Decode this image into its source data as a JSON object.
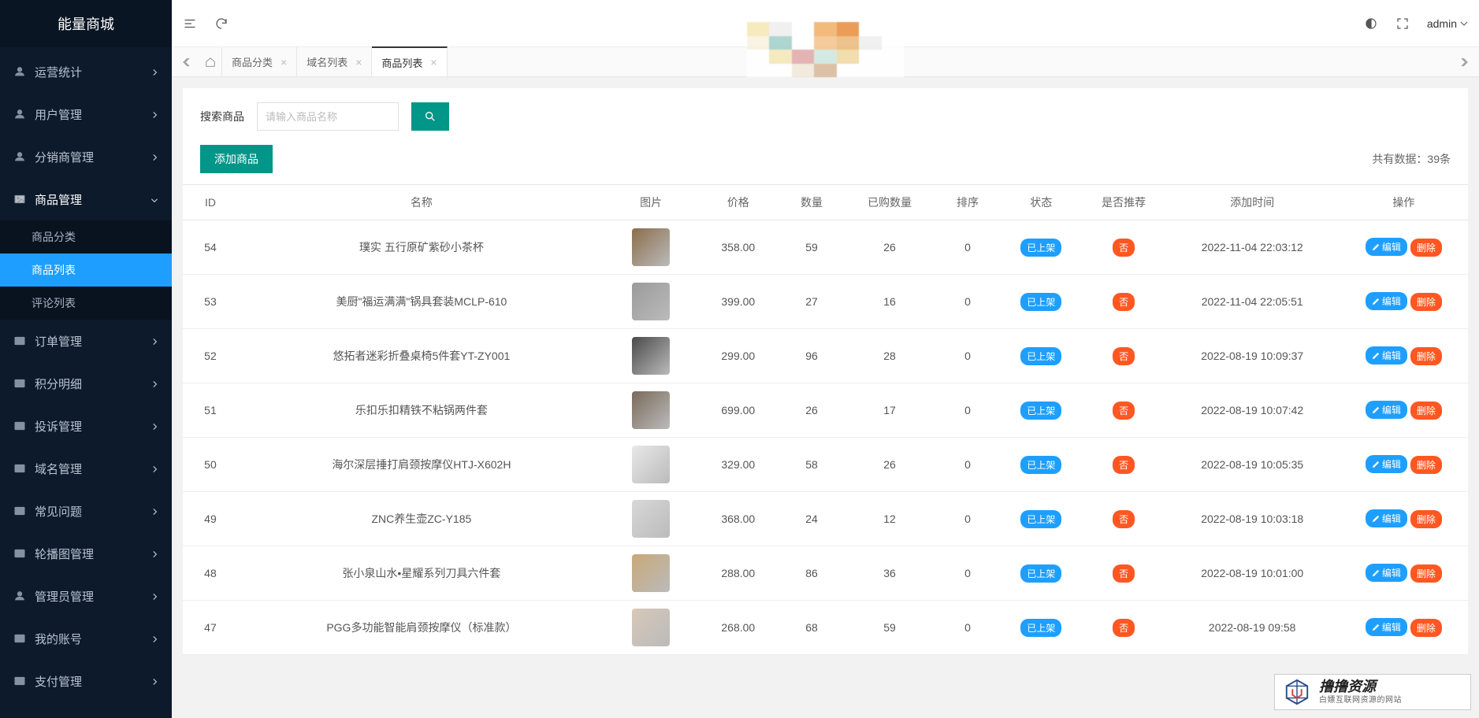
{
  "app": {
    "title": "能量商城",
    "admin": "admin"
  },
  "sidebar": {
    "items": [
      {
        "label": "运营统计"
      },
      {
        "label": "用户管理"
      },
      {
        "label": "分销商管理"
      },
      {
        "label": "商品管理",
        "active": true,
        "expanded": true,
        "children": [
          {
            "label": "商品分类"
          },
          {
            "label": "商品列表",
            "selected": true
          },
          {
            "label": "评论列表"
          }
        ]
      },
      {
        "label": "订单管理"
      },
      {
        "label": "积分明细"
      },
      {
        "label": "投诉管理"
      },
      {
        "label": "域名管理"
      },
      {
        "label": "常见问题"
      },
      {
        "label": "轮播图管理"
      },
      {
        "label": "管理员管理"
      },
      {
        "label": "我的账号"
      },
      {
        "label": "支付管理"
      }
    ]
  },
  "tabs": {
    "items": [
      {
        "label": "商品分类"
      },
      {
        "label": "域名列表"
      },
      {
        "label": "商品列表",
        "active": true
      }
    ]
  },
  "search": {
    "label": "搜索商品",
    "placeholder": "请输入商品名称"
  },
  "actions": {
    "add": "添加商品",
    "count_prefix": "共有数据：",
    "count": "39条"
  },
  "table": {
    "headers": {
      "id": "ID",
      "name": "名称",
      "img": "图片",
      "price": "价格",
      "qty": "数量",
      "bought": "已购数量",
      "sort": "排序",
      "status": "状态",
      "rec": "是否推荐",
      "time": "添加时间",
      "ops": "操作"
    },
    "status_label": "已上架",
    "rec_no": "否",
    "edit": "编辑",
    "del": "删除",
    "rows": [
      {
        "id": "54",
        "name": "璞实 五行原矿紫砂小茶杯",
        "price": "358.00",
        "qty": "59",
        "bought": "26",
        "sort": "0",
        "time": "2022-11-04 22:03:12"
      },
      {
        "id": "53",
        "name": "美厨\"福运满满\"锅具套装MCLP-610",
        "price": "399.00",
        "qty": "27",
        "bought": "16",
        "sort": "0",
        "time": "2022-11-04 22:05:51"
      },
      {
        "id": "52",
        "name": "悠拓者迷彩折叠桌椅5件套YT-ZY001",
        "price": "299.00",
        "qty": "96",
        "bought": "28",
        "sort": "0",
        "time": "2022-08-19 10:09:37"
      },
      {
        "id": "51",
        "name": "乐扣乐扣精铁不粘锅两件套",
        "price": "699.00",
        "qty": "26",
        "bought": "17",
        "sort": "0",
        "time": "2022-08-19 10:07:42"
      },
      {
        "id": "50",
        "name": "海尔深层捶打肩颈按摩仪HTJ-X602H",
        "price": "329.00",
        "qty": "58",
        "bought": "26",
        "sort": "0",
        "time": "2022-08-19 10:05:35"
      },
      {
        "id": "49",
        "name": "ZNC养生壶ZC-Y185",
        "price": "368.00",
        "qty": "24",
        "bought": "12",
        "sort": "0",
        "time": "2022-08-19 10:03:18"
      },
      {
        "id": "48",
        "name": "张小泉山水•星耀系列刀具六件套",
        "price": "288.00",
        "qty": "86",
        "bought": "36",
        "sort": "0",
        "time": "2022-08-19 10:01:00"
      },
      {
        "id": "47",
        "name": "PGG多功能智能肩颈按摩仪（标准款）",
        "price": "268.00",
        "qty": "68",
        "bought": "59",
        "sort": "0",
        "time": "2022-08-19 09:58"
      }
    ]
  },
  "watermark": {
    "title": "撸撸资源",
    "sub": "白嫖互联网资源的网站"
  }
}
